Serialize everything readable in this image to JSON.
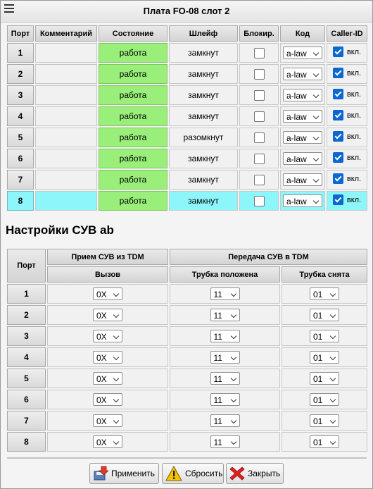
{
  "window": {
    "title": "Плата FO-08 слот 2"
  },
  "ports_table": {
    "headers": {
      "port": "Порт",
      "comment": "Комментарий",
      "state": "Состояние",
      "loop": "Шлейф",
      "block": "Блокир.",
      "code": "Код",
      "caller_id": "Caller-ID"
    },
    "rows": [
      {
        "port": "1",
        "comment": "",
        "state": "работа",
        "loop": "замкнут",
        "code": "a-law",
        "cid": "вкл."
      },
      {
        "port": "2",
        "comment": "",
        "state": "работа",
        "loop": "замкнут",
        "code": "a-law",
        "cid": "вкл."
      },
      {
        "port": "3",
        "comment": "",
        "state": "работа",
        "loop": "замкнут",
        "code": "a-law",
        "cid": "вкл."
      },
      {
        "port": "4",
        "comment": "",
        "state": "работа",
        "loop": "замкнут",
        "code": "a-law",
        "cid": "вкл."
      },
      {
        "port": "5",
        "comment": "",
        "state": "работа",
        "loop": "разомкнут",
        "code": "a-law",
        "cid": "вкл."
      },
      {
        "port": "6",
        "comment": "",
        "state": "работа",
        "loop": "замкнут",
        "code": "a-law",
        "cid": "вкл."
      },
      {
        "port": "7",
        "comment": "",
        "state": "работа",
        "loop": "замкнут",
        "code": "a-law",
        "cid": "вкл."
      },
      {
        "port": "8",
        "comment": "",
        "state": "работа",
        "loop": "замкнут",
        "code": "a-law",
        "cid": "вкл."
      }
    ],
    "selected_row": "8"
  },
  "suv_section": {
    "title": "Настройки СУВ ab"
  },
  "suv_table": {
    "headers": {
      "port": "Порт",
      "receive_group": "Прием СУВ из TDM",
      "transmit_group": "Передача СУВ в TDM",
      "call": "Вызов",
      "on_hook": "Трубка положена",
      "off_hook": "Трубка снята"
    },
    "rows": [
      {
        "port": "1",
        "call": "0X",
        "on_hook": "11",
        "off_hook": "01"
      },
      {
        "port": "2",
        "call": "0X",
        "on_hook": "11",
        "off_hook": "01"
      },
      {
        "port": "3",
        "call": "0X",
        "on_hook": "11",
        "off_hook": "01"
      },
      {
        "port": "4",
        "call": "0X",
        "on_hook": "11",
        "off_hook": "01"
      },
      {
        "port": "5",
        "call": "0X",
        "on_hook": "11",
        "off_hook": "01"
      },
      {
        "port": "6",
        "call": "0X",
        "on_hook": "11",
        "off_hook": "01"
      },
      {
        "port": "7",
        "call": "0X",
        "on_hook": "11",
        "off_hook": "01"
      },
      {
        "port": "8",
        "call": "0X",
        "on_hook": "11",
        "off_hook": "01"
      }
    ]
  },
  "buttons": {
    "apply": "Применить",
    "reset": "Сбросить",
    "close": "Закрыть"
  },
  "icons": {
    "menu": "hamburger-menu-icon",
    "apply": "apply-disk-icon",
    "reset": "warning-icon",
    "close": "close-x-icon"
  },
  "colors": {
    "state_ok": "#99ef7a",
    "selected_row": "#8cf6fa",
    "checkbox": "#0b67d1",
    "close_icon": "#e02020",
    "warning_icon": "#f5c400"
  }
}
